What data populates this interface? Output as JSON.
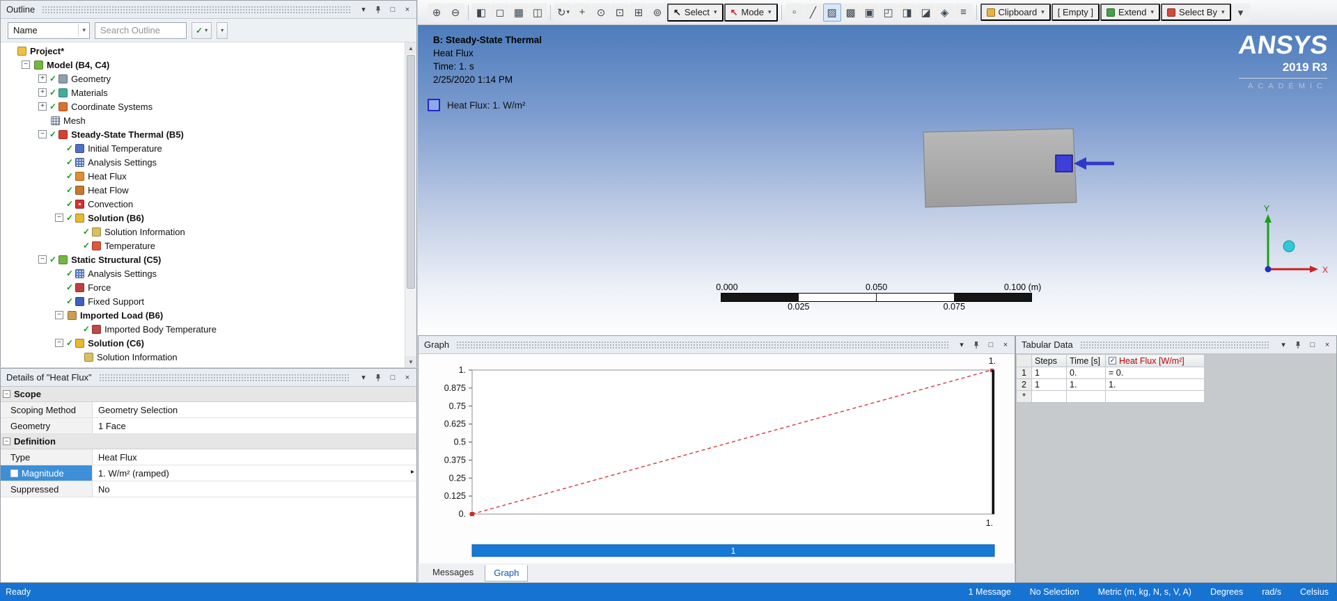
{
  "outline": {
    "title": "Outline",
    "name_label": "Name",
    "search_placeholder": "Search Outline",
    "tree": [
      {
        "label": "Project*",
        "level": 0,
        "icon": "project",
        "bold": true,
        "expander": null,
        "check": false
      },
      {
        "label": "Model (B4, C4)",
        "level": 1,
        "icon": "model",
        "bold": true,
        "expander": "minus",
        "check": false
      },
      {
        "label": "Geometry",
        "level": 2,
        "icon": "geometry",
        "bold": false,
        "expander": "plus",
        "check": true
      },
      {
        "label": "Materials",
        "level": 2,
        "icon": "materials",
        "bold": false,
        "expander": "plus",
        "check": true
      },
      {
        "label": "Coordinate Systems",
        "level": 2,
        "icon": "coordsys",
        "bold": false,
        "expander": "plus",
        "check": true
      },
      {
        "label": "Mesh",
        "level": 2,
        "icon": "mesh",
        "bold": false,
        "expander": null,
        "check": false
      },
      {
        "label": "Steady-State Thermal (B5)",
        "level": 2,
        "icon": "thermal",
        "bold": true,
        "expander": "minus",
        "check": true
      },
      {
        "label": "Initial Temperature",
        "level": 3,
        "icon": "inittemp",
        "bold": false,
        "expander": null,
        "check": true
      },
      {
        "label": "Analysis Settings",
        "level": 3,
        "icon": "settings",
        "bold": false,
        "expander": null,
        "check": true
      },
      {
        "label": "Heat Flux",
        "level": 3,
        "icon": "heatflux",
        "bold": false,
        "expander": null,
        "check": true
      },
      {
        "label": "Heat Flow",
        "level": 3,
        "icon": "heatflow",
        "bold": false,
        "expander": null,
        "check": true
      },
      {
        "label": "Convection",
        "level": 3,
        "icon": "convection",
        "bold": false,
        "expander": null,
        "check": true
      },
      {
        "label": "Solution (B6)",
        "level": 3,
        "icon": "solution",
        "bold": true,
        "expander": "minus",
        "check": true
      },
      {
        "label": "Solution Information",
        "level": 4,
        "icon": "solinfo",
        "bold": false,
        "expander": null,
        "check": true
      },
      {
        "label": "Temperature",
        "level": 4,
        "icon": "temperature",
        "bold": false,
        "expander": null,
        "check": true
      },
      {
        "label": "Static Structural (C5)",
        "level": 2,
        "icon": "structural",
        "bold": true,
        "expander": "minus",
        "check": true
      },
      {
        "label": "Analysis Settings",
        "level": 3,
        "icon": "settings",
        "bold": false,
        "expander": null,
        "check": true
      },
      {
        "label": "Force",
        "level": 3,
        "icon": "force",
        "bold": false,
        "expander": null,
        "check": true
      },
      {
        "label": "Fixed Support",
        "level": 3,
        "icon": "fixedsupport",
        "bold": false,
        "expander": null,
        "check": true
      },
      {
        "label": "Imported Load (B6)",
        "level": 3,
        "icon": "importedload",
        "bold": true,
        "expander": "minus",
        "check": false
      },
      {
        "label": "Imported Body Temperature",
        "level": 4,
        "icon": "importedtemp",
        "bold": false,
        "expander": null,
        "check": true
      },
      {
        "label": "Solution (C6)",
        "level": 3,
        "icon": "solution",
        "bold": true,
        "expander": "minus",
        "check": true
      },
      {
        "label": "Solution Information",
        "level": 4,
        "icon": "solinfo",
        "bold": false,
        "expander": null,
        "check": false
      }
    ]
  },
  "details": {
    "title": "Details of \"Heat Flux\"",
    "rows": [
      {
        "type": "section",
        "label": "Scope"
      },
      {
        "type": "prop",
        "label": "Scoping Method",
        "value": "Geometry Selection"
      },
      {
        "type": "prop",
        "label": "Geometry",
        "value": "1 Face"
      },
      {
        "type": "section",
        "label": "Definition"
      },
      {
        "type": "prop",
        "label": "Type",
        "value": "Heat Flux"
      },
      {
        "type": "prop",
        "label": "Magnitude",
        "value": "1. W/m²  (ramped)",
        "selected": true,
        "checkbox": true,
        "flyout": true
      },
      {
        "type": "prop",
        "label": "Suppressed",
        "value": "No"
      }
    ]
  },
  "toolbar": {
    "items": [
      {
        "kind": "icon",
        "name": "zoom-in-icon",
        "glyph": "⊕"
      },
      {
        "kind": "icon",
        "name": "zoom-out-icon",
        "glyph": "⊖"
      },
      {
        "kind": "sep"
      },
      {
        "kind": "icon",
        "name": "shaded-view-icon",
        "glyph": "◧"
      },
      {
        "kind": "icon",
        "name": "wireframe-view-icon",
        "glyph": "◻"
      },
      {
        "kind": "icon",
        "name": "show-mesh-icon",
        "glyph": "▦"
      },
      {
        "kind": "icon",
        "name": "section-plane-icon",
        "glyph": "◫"
      },
      {
        "kind": "sep"
      },
      {
        "kind": "icon",
        "name": "rotate-icon",
        "glyph": "↻",
        "dropdown": true
      },
      {
        "kind": "icon",
        "name": "pan-icon",
        "glyph": "+"
      },
      {
        "kind": "icon",
        "name": "zoom-mode-icon",
        "glyph": "⊙"
      },
      {
        "kind": "icon",
        "name": "box-zoom-icon",
        "glyph": "⊡"
      },
      {
        "kind": "icon",
        "name": "zoom-to-fit-icon",
        "glyph": "⊞"
      },
      {
        "kind": "icon",
        "name": "magnifier-window-icon",
        "glyph": "⊚"
      },
      {
        "kind": "label",
        "name": "select-menu",
        "cursor": "#1a1a1a",
        "label": "Select",
        "dropdown": true
      },
      {
        "kind": "label",
        "name": "mode-menu",
        "cursor": "#cc2222",
        "label": "Mode",
        "dropdown": true
      },
      {
        "kind": "sep"
      },
      {
        "kind": "icon",
        "name": "vertex-filter-icon",
        "glyph": "▫"
      },
      {
        "kind": "icon",
        "name": "edge-filter-icon",
        "glyph": "╱"
      },
      {
        "kind": "icon",
        "name": "face-filter-icon",
        "glyph": "▨",
        "active": true
      },
      {
        "kind": "icon",
        "name": "body-filter-icon",
        "glyph": "▩"
      },
      {
        "kind": "icon",
        "name": "single-select-icon",
        "glyph": "▣"
      },
      {
        "kind": "icon",
        "name": "box-select-icon",
        "glyph": "◰"
      },
      {
        "kind": "icon",
        "name": "adjacent-select-icon",
        "glyph": "◨"
      },
      {
        "kind": "icon",
        "name": "flood-select-icon",
        "glyph": "◪"
      },
      {
        "kind": "icon",
        "name": "coordinates-icon",
        "glyph": "◈"
      },
      {
        "kind": "icon",
        "name": "manage-views-icon",
        "glyph": "≡"
      },
      {
        "kind": "sep"
      },
      {
        "kind": "label",
        "name": "clipboard-menu",
        "swatch": "#e8b33c",
        "label": "Clipboard",
        "dropdown": true
      },
      {
        "kind": "label",
        "name": "clipboard-state",
        "label": "[ Empty ]"
      },
      {
        "kind": "label",
        "name": "extend-menu",
        "swatch": "#43a047",
        "label": "Extend",
        "dropdown": true
      },
      {
        "kind": "label",
        "name": "select-by-menu",
        "swatch": "#d2493b",
        "label": "Select By",
        "dropdown": true
      },
      {
        "kind": "icon",
        "name": "toolbar-options-icon",
        "glyph": "▾"
      }
    ]
  },
  "viewport": {
    "header": {
      "line1": "B: Steady-State Thermal",
      "line2": "Heat Flux",
      "line3": "Time: 1. s",
      "line4": "2/25/2020 1:14 PM"
    },
    "legend": {
      "label": "Heat Flux: 1. W/m²"
    },
    "logo": {
      "brand": "ANSYS",
      "version": "2019 R3",
      "edition": "ACADEMIC"
    },
    "ruler": {
      "labels_top": [
        "0.000",
        "0.050",
        "0.100 (m)"
      ],
      "labels_bottom": [
        "0.025",
        "0.075"
      ]
    },
    "triad": {
      "x_label": "X",
      "y_label": "Y"
    }
  },
  "graph_panel": {
    "title": "Graph",
    "tabs": [
      "Messages",
      "Graph"
    ],
    "active_tab": "Graph"
  },
  "chart_data": {
    "type": "line",
    "title": "Graph",
    "x": [
      0,
      1
    ],
    "series": [
      {
        "name": "Heat Flux [W/m²]",
        "values": [
          0,
          1
        ]
      }
    ],
    "xlim": [
      0,
      1
    ],
    "ylim": [
      0,
      1
    ],
    "yticks": [
      "1.",
      "0.875",
      "0.75",
      "0.625",
      "0.5",
      "0.375",
      "0.25",
      "0.125",
      "0."
    ],
    "ytick_values": [
      1,
      0.875,
      0.75,
      0.625,
      0.5,
      0.375,
      0.25,
      0.125,
      0
    ],
    "x_axis_end_label": "1.",
    "point_peak_label": "1.",
    "time_marker_x": 1,
    "time_bar_label": "1",
    "line_color": "#d42a2a",
    "line_style": "dashed",
    "time_bar_color": "#1779d6",
    "grid": false,
    "legend_position": "none"
  },
  "tabular": {
    "title": "Tabular Data",
    "columns": [
      "Steps",
      "Time [s]",
      "Heat Flux [W/m²]"
    ],
    "flux_header_checked": true,
    "flux_header_color": "#c00000",
    "rows": [
      {
        "num": "1",
        "steps": "1",
        "time": "0.",
        "flux": "= 0."
      },
      {
        "num": "2",
        "steps": "1",
        "time": "1.",
        "flux": "1."
      },
      {
        "num": "*",
        "steps": "",
        "time": "",
        "flux": ""
      }
    ]
  },
  "status": {
    "left": "Ready",
    "items": [
      "1 Message",
      "No Selection",
      "Metric (m, kg, N, s, V, A)",
      "Degrees",
      "rad/s",
      "Celsius"
    ]
  }
}
